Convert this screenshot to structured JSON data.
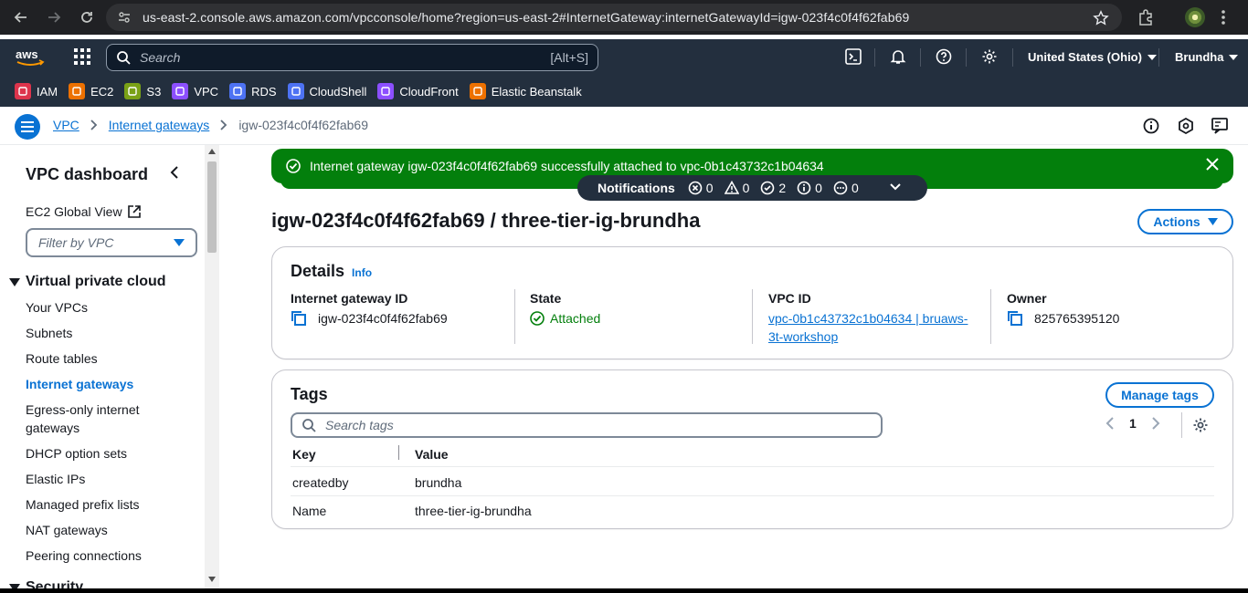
{
  "browser": {
    "url": "us-east-2.console.aws.amazon.com/vpcconsole/home?region=us-east-2#InternetGateway:internetGatewayId=igw-023f4c0f4f62fab69"
  },
  "topnav": {
    "search_placeholder": "Search",
    "search_shortcut": "[Alt+S]",
    "region": "United States (Ohio)",
    "user": "Brundha"
  },
  "favorites": [
    {
      "label": "IAM",
      "color": "#dd344c"
    },
    {
      "label": "EC2",
      "color": "#ed7100"
    },
    {
      "label": "S3",
      "color": "#7aa116"
    },
    {
      "label": "VPC",
      "color": "#8c4fff"
    },
    {
      "label": "RDS",
      "color": "#4d72f3"
    },
    {
      "label": "CloudShell",
      "color": "#4d72f3"
    },
    {
      "label": "CloudFront",
      "color": "#8c4fff"
    },
    {
      "label": "Elastic Beanstalk",
      "color": "#ed7100"
    }
  ],
  "breadcrumb": {
    "items": [
      "VPC",
      "Internet gateways"
    ],
    "current": "igw-023f4c0f4f62fab69"
  },
  "sidebar": {
    "title": "VPC dashboard",
    "ec2_global": "EC2 Global View",
    "filter_placeholder": "Filter by VPC",
    "section": "Virtual private cloud",
    "items": [
      "Your VPCs",
      "Subnets",
      "Route tables",
      "Internet gateways",
      "Egress-only internet gateways",
      "DHCP option sets",
      "Elastic IPs",
      "Managed prefix lists",
      "NAT gateways",
      "Peering connections"
    ],
    "active_item": "Internet gateways",
    "next_section": "Security"
  },
  "flash": {
    "message": "Internet gateway igw-023f4c0f4f62fab69 successfully attached to vpc-0b1c43732c1b04634",
    "color": "#037f0c"
  },
  "notifications": {
    "label": "Notifications",
    "error": "0",
    "warning": "0",
    "success": "2",
    "info": "0",
    "in_progress": "0"
  },
  "page": {
    "title": "igw-023f4c0f4f62fab69 / three-tier-ig-brundha",
    "actions_label": "Actions"
  },
  "details": {
    "heading": "Details",
    "info": "Info",
    "igw_label": "Internet gateway ID",
    "igw_value": "igw-023f4c0f4f62fab69",
    "state_label": "State",
    "state_value": "Attached",
    "vpc_label": "VPC ID",
    "vpc_value_line1": "vpc-0b1c43732c1b04634 | bruaws-",
    "vpc_value_line2": "3t-workshop",
    "owner_label": "Owner",
    "owner_value": "825765395120"
  },
  "tags": {
    "heading": "Tags",
    "manage_label": "Manage tags",
    "search_placeholder": "Search tags",
    "page": "1",
    "col_key": "Key",
    "col_value": "Value",
    "rows": [
      {
        "key": "createdby",
        "value": "brundha"
      },
      {
        "key": "Name",
        "value": "three-tier-ig-brundha"
      }
    ]
  }
}
